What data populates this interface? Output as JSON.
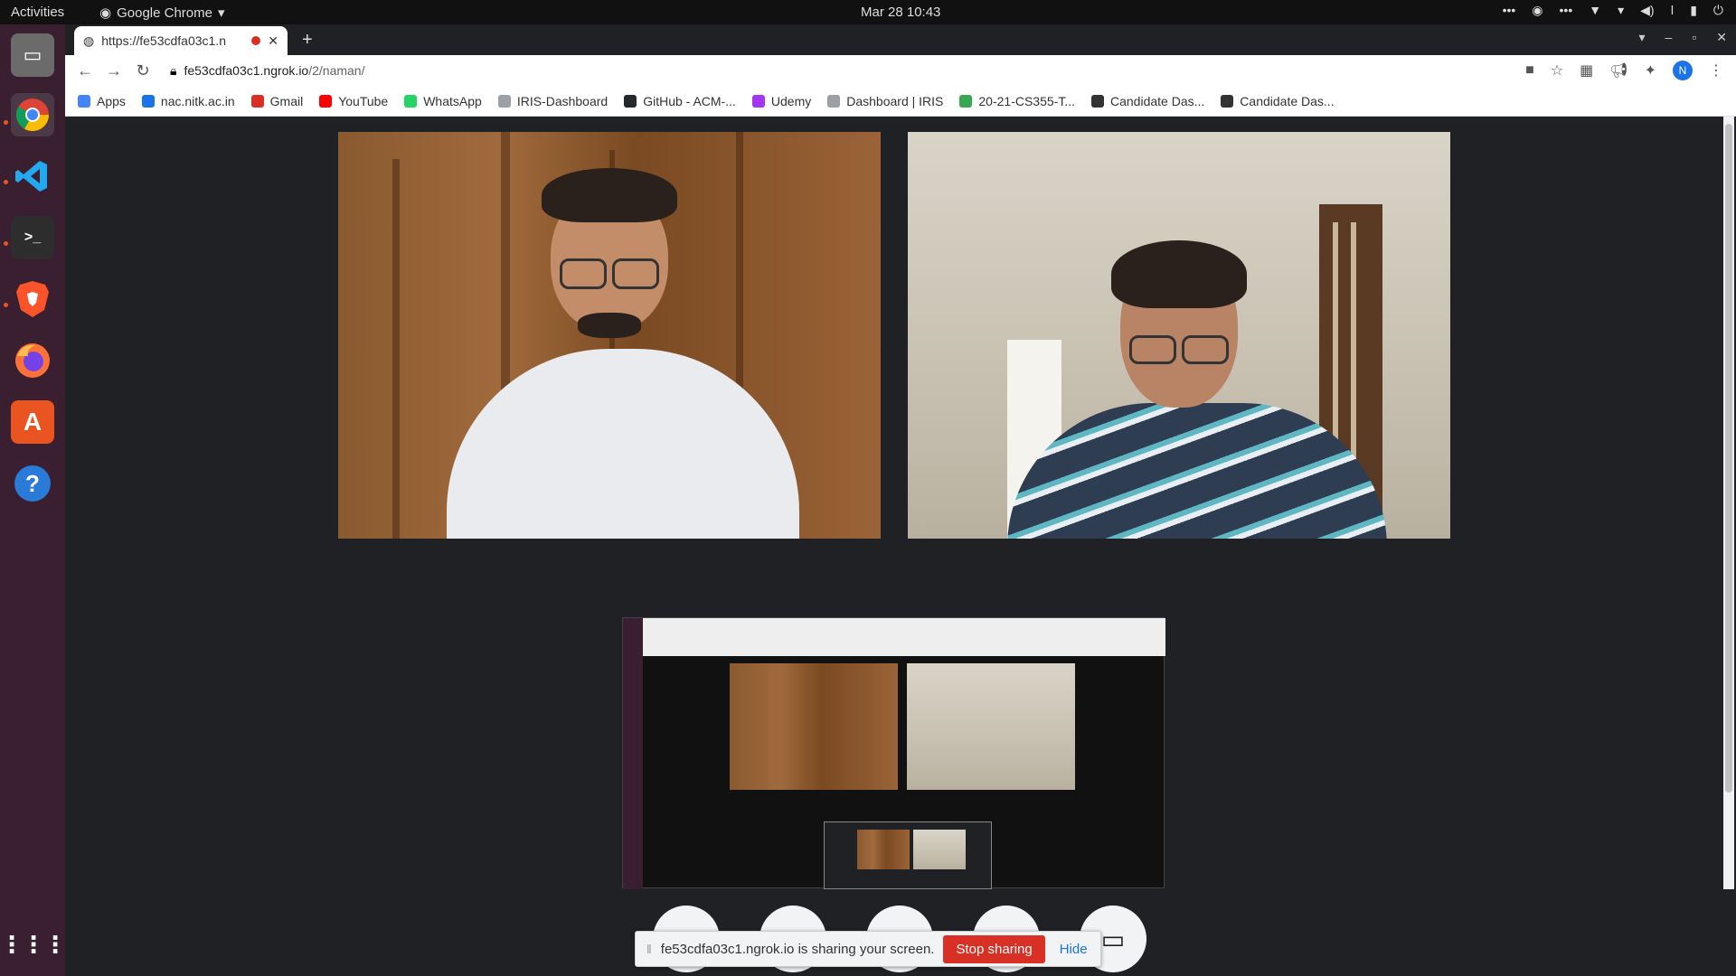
{
  "system_bar": {
    "activities": "Activities",
    "app_name": "Google Chrome",
    "datetime": "Mar 28  10:43"
  },
  "tab": {
    "title": "https://fe53cdfa03c1.n",
    "new_tab_symbol": "+"
  },
  "address": {
    "host": "fe53cdfa03c1.ngrok.io",
    "path": "/2/naman/"
  },
  "profile_initial": "N",
  "bookmarks": [
    {
      "label": "Apps",
      "icon_color": "#4285f4"
    },
    {
      "label": "nac.nitk.ac.in",
      "icon_color": "#1a73e8"
    },
    {
      "label": "Gmail",
      "icon_color": "#d93025"
    },
    {
      "label": "YouTube",
      "icon_color": "#ff0000"
    },
    {
      "label": "WhatsApp",
      "icon_color": "#25d366"
    },
    {
      "label": "IRIS-Dashboard",
      "icon_color": "#9aa0a6"
    },
    {
      "label": "GitHub - ACM-...",
      "icon_color": "#24292e"
    },
    {
      "label": "Udemy",
      "icon_color": "#a435f0"
    },
    {
      "label": "Dashboard | IRIS",
      "icon_color": "#9aa0a6"
    },
    {
      "label": "20-21-CS355-T...",
      "icon_color": "#34a853"
    },
    {
      "label": "Candidate Das...",
      "icon_color": "#333333"
    },
    {
      "label": "Candidate Das...",
      "icon_color": "#333333"
    }
  ],
  "share_bar": {
    "message": "fe53cdfa03c1.ngrok.io is sharing your screen.",
    "stop_label": "Stop sharing",
    "hide_label": "Hide"
  }
}
